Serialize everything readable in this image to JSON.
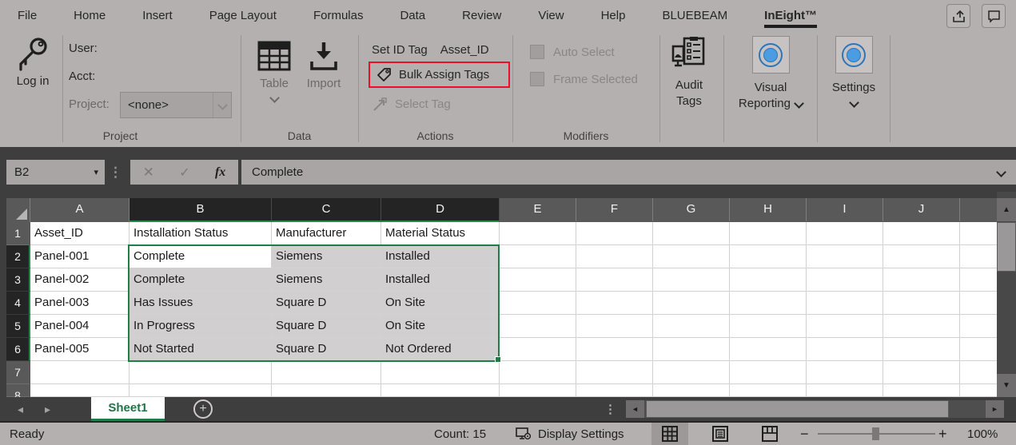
{
  "menu": {
    "tabs": [
      "File",
      "Home",
      "Insert",
      "Page Layout",
      "Formulas",
      "Data",
      "Review",
      "View",
      "Help",
      "BLUEBEAM",
      "InEight™"
    ],
    "active_tab": "InEight™"
  },
  "ribbon": {
    "project": {
      "login": "Log in",
      "user_label": "User:",
      "acct_label": "Acct:",
      "project_label": "Project:",
      "project_value": "<none>",
      "group": "Project"
    },
    "data": {
      "table": "Table",
      "import": "Import",
      "group": "Data"
    },
    "actions": {
      "set_id_tag": "Set ID Tag",
      "set_id_tag_value": "Asset_ID",
      "bulk_assign": "Bulk Assign Tags",
      "select_tag": "Select Tag",
      "group": "Actions"
    },
    "modifiers": {
      "auto_select": "Auto Select",
      "frame_selected": "Frame Selected",
      "group": "Modifiers"
    },
    "audit_tags": "Audit Tags",
    "visual_reporting": "Visual Reporting",
    "settings": "Settings"
  },
  "formula_bar": {
    "name_box": "B2",
    "fx": "fx",
    "value": "Complete"
  },
  "grid": {
    "columns": [
      "A",
      "B",
      "C",
      "D",
      "E",
      "F",
      "G",
      "H",
      "I",
      "J"
    ],
    "rows": [
      "1",
      "2",
      "3",
      "4",
      "5",
      "6",
      "7",
      "8"
    ],
    "selected_columns": [
      "B",
      "C",
      "D"
    ],
    "selected_rows": [
      "2",
      "3",
      "4",
      "5",
      "6"
    ],
    "active_cell": "B2",
    "table": {
      "headers": [
        "Asset_ID",
        "Installation Status",
        "Manufacturer",
        "Material Status"
      ],
      "rows": [
        [
          "Panel-001",
          "Complete",
          "Siemens",
          "Installed"
        ],
        [
          "Panel-002",
          "Complete",
          "Siemens",
          "Installed"
        ],
        [
          "Panel-003",
          "Has Issues",
          "Square D",
          "On Site"
        ],
        [
          "Panel-004",
          "In Progress",
          "Square D",
          "On Site"
        ],
        [
          "Panel-005",
          "Not Started",
          "Square D",
          "Not Ordered"
        ]
      ]
    }
  },
  "sheet_tabs": {
    "active": "Sheet1"
  },
  "status_bar": {
    "ready": "Ready",
    "count": "Count: 15",
    "display_settings": "Display Settings",
    "zoom": "100%"
  },
  "icons": {
    "name_box_dropdown": "▾",
    "cancel": "✕",
    "enter": "✓",
    "dots": "⋮",
    "tab_left": "◂",
    "tab_right": "▸",
    "scroll_left": "◄",
    "scroll_right": "►",
    "scroll_up": "▲",
    "scroll_down": "▼",
    "zoom_out": "−",
    "zoom_in": "+",
    "new_sheet": "+"
  },
  "colors": {
    "accent_green": "#1e7e46",
    "highlight_red": "#e8112d",
    "icon_blue": "#2e75b6",
    "selection_fill": "#d1cfcf",
    "header_selected": "#242424"
  }
}
